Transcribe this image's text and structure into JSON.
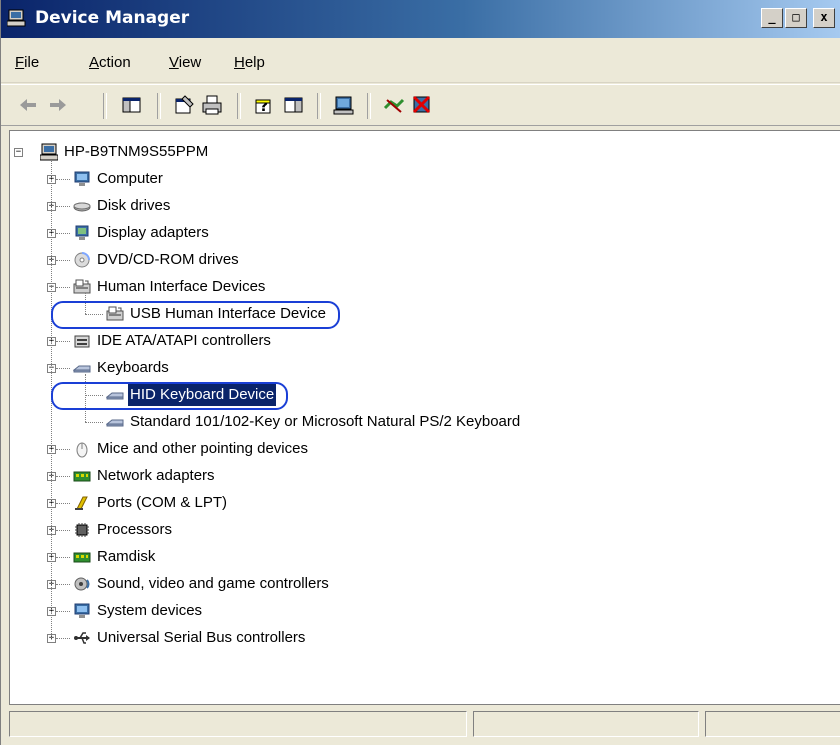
{
  "window": {
    "title": "Device Manager"
  },
  "title_buttons": [
    "_",
    "□",
    "x"
  ],
  "menu": [
    {
      "label": "File",
      "accel": "F",
      "rest": "ile"
    },
    {
      "label": "Action",
      "accel": "A",
      "rest": "ction"
    },
    {
      "label": "View",
      "accel": "V",
      "rest": "iew"
    },
    {
      "label": "Help",
      "accel": "H",
      "rest": "elp"
    }
  ],
  "toolbar": {
    "icons": [
      "back-arrow-icon",
      "forward-arrow-icon",
      "show-hide-console-tree-icon",
      "properties-icon",
      "print-icon",
      "help-icon",
      "show-action-pane-icon",
      "scan-hardware-icon",
      "disable-device-icon",
      "uninstall-device-icon"
    ]
  },
  "tree": {
    "root": "HP-B9TNM9S55PPM",
    "categories": [
      {
        "label": "Computer",
        "icon": "computer-icon",
        "expanded": false
      },
      {
        "label": "Disk drives",
        "icon": "disk-drive-icon",
        "expanded": false
      },
      {
        "label": "Display adapters",
        "icon": "display-adapter-icon",
        "expanded": false
      },
      {
        "label": "DVD/CD-ROM drives",
        "icon": "dvd-drive-icon",
        "expanded": false
      },
      {
        "label": "Human Interface Devices",
        "icon": "hid-icon",
        "expanded": true,
        "children": [
          {
            "label": "USB Human Interface Device",
            "icon": "hid-icon",
            "highlighted": true
          }
        ]
      },
      {
        "label": "IDE ATA/ATAPI controllers",
        "icon": "ide-controller-icon",
        "expanded": false
      },
      {
        "label": "Keyboards",
        "icon": "keyboard-icon",
        "expanded": true,
        "children": [
          {
            "label": "HID Keyboard Device",
            "icon": "keyboard-icon",
            "selected": true,
            "highlighted": true
          },
          {
            "label": "Standard 101/102-Key or Microsoft Natural PS/2 Keyboard",
            "icon": "keyboard-icon"
          }
        ]
      },
      {
        "label": "Mice and other pointing devices",
        "icon": "mouse-icon",
        "expanded": false
      },
      {
        "label": "Network adapters",
        "icon": "network-adapter-icon",
        "expanded": false
      },
      {
        "label": "Ports (COM & LPT)",
        "icon": "port-icon",
        "expanded": false
      },
      {
        "label": "Processors",
        "icon": "processor-icon",
        "expanded": false
      },
      {
        "label": "Ramdisk",
        "icon": "ramdisk-icon",
        "expanded": false
      },
      {
        "label": "Sound, video and game controllers",
        "icon": "sound-icon",
        "expanded": false
      },
      {
        "label": "System devices",
        "icon": "system-device-icon",
        "expanded": false
      },
      {
        "label": "Universal Serial Bus controllers",
        "icon": "usb-icon",
        "expanded": false
      }
    ]
  },
  "colors": {
    "selection": "#0a246a",
    "highlight_ring": "#1a3fd6",
    "title_start": "#0a246a",
    "title_end": "#a6caf0"
  }
}
